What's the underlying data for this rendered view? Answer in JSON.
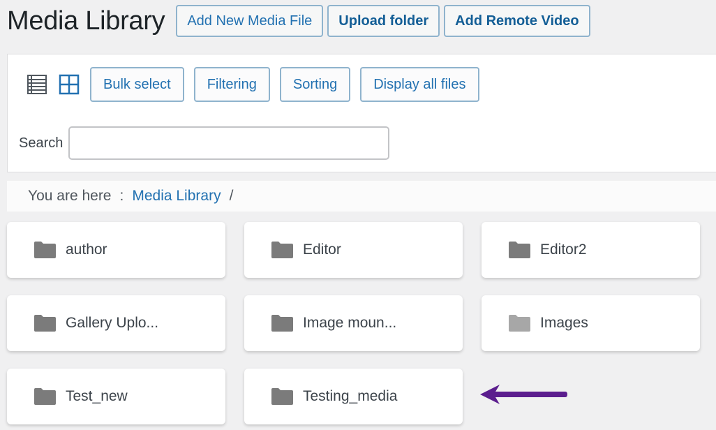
{
  "header": {
    "title": "Media Library",
    "buttons": {
      "add_new_media_file": "Add New Media File",
      "upload_folder": "Upload folder",
      "add_remote_video": "Add Remote Video"
    }
  },
  "toolbar": {
    "view_icons": [
      "list-view-icon",
      "grid-view-icon"
    ],
    "active_view": "grid",
    "buttons": {
      "bulk_select": "Bulk select",
      "filtering": "Filtering",
      "sorting": "Sorting",
      "display_all_files": "Display all files"
    },
    "search": {
      "label": "Search",
      "value": "",
      "placeholder": ""
    }
  },
  "breadcrumb": {
    "prefix": "You are here",
    "separator": ":",
    "current": "Media Library",
    "trailing": "/"
  },
  "folders": [
    {
      "name": "author",
      "icon": "folder-icon"
    },
    {
      "name": "Editor",
      "icon": "folder-icon"
    },
    {
      "name": "Editor2",
      "icon": "folder-icon"
    },
    {
      "name": "Gallery Uplo...",
      "icon": "folder-icon"
    },
    {
      "name": "Image moun...",
      "icon": "folder-icon"
    },
    {
      "name": "Images",
      "icon": "folder-icon",
      "muted": true
    },
    {
      "name": "Test_new",
      "icon": "folder-icon"
    },
    {
      "name": "Testing_media",
      "icon": "folder-icon"
    }
  ],
  "annotation": {
    "icon": "arrow-left-icon",
    "color": "#5b1d8e"
  },
  "colors": {
    "accent": "#2271b1",
    "folder": "#7b7b7b",
    "folder_muted": "#a7a7a7",
    "background": "#f0f0f1"
  }
}
